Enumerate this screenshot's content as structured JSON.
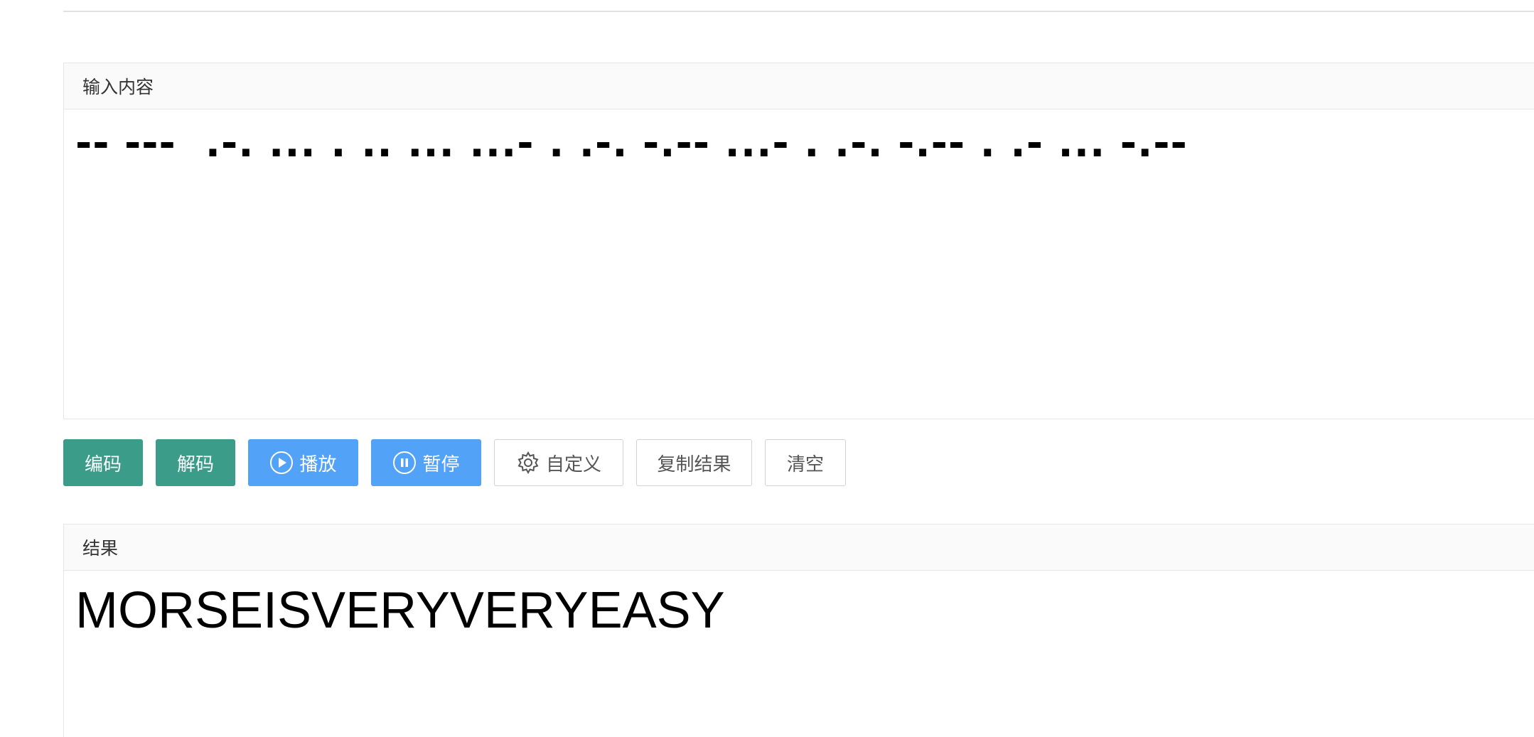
{
  "input_panel": {
    "title": "输入内容",
    "value": "-- ---  .-. ... . .. ... ...- . .-. -.-- ...- . .-. -.-- . .- ... -.--"
  },
  "toolbar": {
    "encode_label": "编码",
    "decode_label": "解码",
    "play_label": "播放",
    "pause_label": "暂停",
    "custom_label": "自定义",
    "copy_label": "复制结果",
    "clear_label": "清空"
  },
  "result_panel": {
    "title": "结果",
    "value": "MORSEISVERYVERYEASY"
  },
  "icons": {
    "play": "play-circle-icon",
    "pause": "pause-circle-icon",
    "custom": "gear-icon"
  },
  "colors": {
    "primary_green": "#3a9c89",
    "primary_blue": "#52a2f8"
  }
}
